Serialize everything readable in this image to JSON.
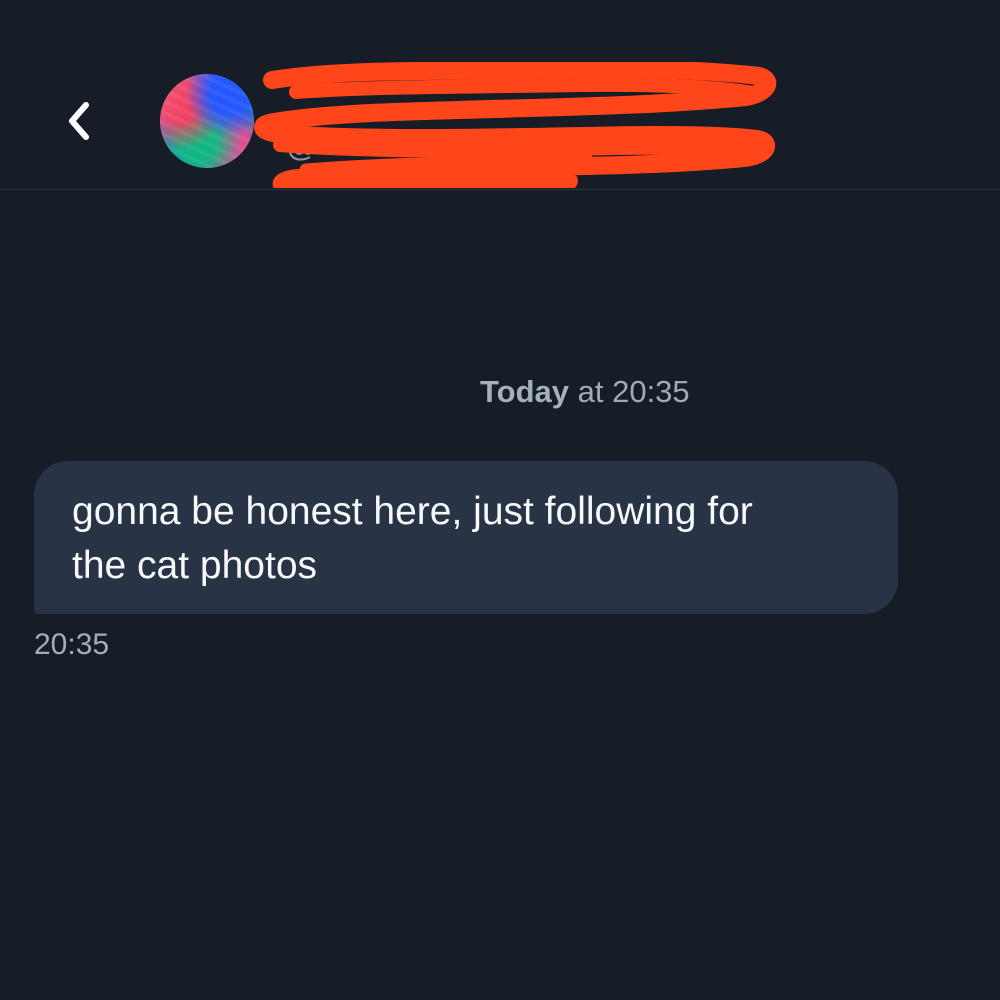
{
  "header": {
    "display_name": "",
    "handle": "@",
    "avatar_icon": "avatar-image-icon",
    "back_icon": "chevron-left-icon"
  },
  "conversation": {
    "date_divider_prefix": "Today",
    "date_divider_suffix": "at 20:35",
    "messages": [
      {
        "text": "gonna be honest here, just following for\nthe cat photos",
        "time": "20:35"
      }
    ]
  },
  "colors": {
    "background": "#161d27",
    "bubble": "#283445",
    "redaction": "#ff461b",
    "muted_text": "#a2acba"
  }
}
